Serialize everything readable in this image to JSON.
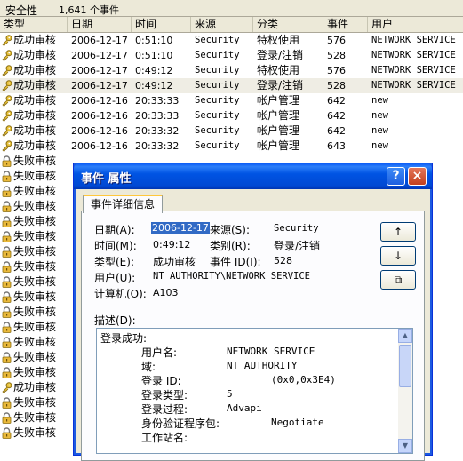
{
  "header": {
    "title": "安全性",
    "count": "1,641 个事件"
  },
  "columns": [
    "类型",
    "日期",
    "时间",
    "来源",
    "分类",
    "事件",
    "用户"
  ],
  "rows": [
    {
      "type": "成功审核",
      "date": "2006-12-17",
      "time": "0:51:10",
      "source": "Security",
      "category": "特权使用",
      "event": "576",
      "user": "NETWORK SERVICE",
      "icon": "key-icon"
    },
    {
      "type": "成功审核",
      "date": "2006-12-17",
      "time": "0:51:10",
      "source": "Security",
      "category": "登录/注销",
      "event": "528",
      "user": "NETWORK SERVICE",
      "icon": "key-icon"
    },
    {
      "type": "成功审核",
      "date": "2006-12-17",
      "time": "0:49:12",
      "source": "Security",
      "category": "特权使用",
      "event": "576",
      "user": "NETWORK SERVICE",
      "icon": "key-icon"
    },
    {
      "type": "成功审核",
      "date": "2006-12-17",
      "time": "0:49:12",
      "source": "Security",
      "category": "登录/注销",
      "event": "528",
      "user": "NETWORK SERVICE",
      "icon": "key-icon",
      "selected": true
    },
    {
      "type": "成功审核",
      "date": "2006-12-16",
      "time": "20:33:33",
      "source": "Security",
      "category": "帐户管理",
      "event": "642",
      "user": "new",
      "icon": "key-icon"
    },
    {
      "type": "成功审核",
      "date": "2006-12-16",
      "time": "20:33:33",
      "source": "Security",
      "category": "帐户管理",
      "event": "642",
      "user": "new",
      "icon": "key-icon"
    },
    {
      "type": "成功审核",
      "date": "2006-12-16",
      "time": "20:33:32",
      "source": "Security",
      "category": "帐户管理",
      "event": "642",
      "user": "new",
      "icon": "key-icon"
    },
    {
      "type": "成功审核",
      "date": "2006-12-16",
      "time": "20:33:32",
      "source": "Security",
      "category": "帐户管理",
      "event": "643",
      "user": "new",
      "icon": "key-icon"
    },
    {
      "type": "失败审核",
      "icon": "lock-icon"
    },
    {
      "type": "失败审核",
      "icon": "lock-icon"
    },
    {
      "type": "失败审核",
      "icon": "lock-icon"
    },
    {
      "type": "失败审核",
      "icon": "lock-icon"
    },
    {
      "type": "失败审核",
      "icon": "lock-icon"
    },
    {
      "type": "失败审核",
      "icon": "lock-icon"
    },
    {
      "type": "失败审核",
      "icon": "lock-icon"
    },
    {
      "type": "失败审核",
      "icon": "lock-icon"
    },
    {
      "type": "失败审核",
      "icon": "lock-icon"
    },
    {
      "type": "失败审核",
      "icon": "lock-icon"
    },
    {
      "type": "失败审核",
      "icon": "lock-icon"
    },
    {
      "type": "失败审核",
      "icon": "lock-icon"
    },
    {
      "type": "失败审核",
      "icon": "lock-icon"
    },
    {
      "type": "失败审核",
      "icon": "lock-icon"
    },
    {
      "type": "失败审核",
      "icon": "lock-icon"
    },
    {
      "type": "成功审核",
      "icon": "key-icon"
    },
    {
      "type": "失败审核",
      "icon": "lock-icon"
    },
    {
      "type": "失败审核",
      "icon": "lock-icon"
    },
    {
      "type": "失败审核",
      "icon": "lock-icon"
    }
  ],
  "dialog": {
    "title": "事件 属性",
    "help_glyph": "?",
    "close_glyph": "×",
    "tab": "事件详细信息",
    "labels": {
      "date": "日期(A):",
      "source": "来源(S):",
      "time": "时间(M):",
      "category": "类别(R):",
      "type": "类型(E):",
      "event_id": "事件 ID(I):",
      "user": "用户(U):",
      "computer": "计算机(O):",
      "description": "描述(D):"
    },
    "values": {
      "date": "2006-12-17",
      "source": "Security",
      "time": "0:49:12",
      "category": "登录/注销",
      "type": "成功审核",
      "event_id": "528",
      "user": "NT AUTHORITY\\NETWORK SERVICE",
      "computer": "A103"
    },
    "nav": {
      "up": "↑",
      "down": "↓",
      "copy": "⧉"
    },
    "description_lines": [
      {
        "label": "登录成功:",
        "value": ""
      },
      {
        "label": "用户名:",
        "value": "NETWORK SERVICE"
      },
      {
        "label": "域:",
        "value": "NT AUTHORITY"
      },
      {
        "label": "登录 ID:",
        "value": "(0x0,0x3E4)"
      },
      {
        "label": "登录类型:",
        "value": "5"
      },
      {
        "label": "登录过程:",
        "value": "Advapi"
      },
      {
        "label": "身份验证程序包:",
        "value": "Negotiate"
      },
      {
        "label": "工作站名:",
        "value": ""
      }
    ]
  }
}
